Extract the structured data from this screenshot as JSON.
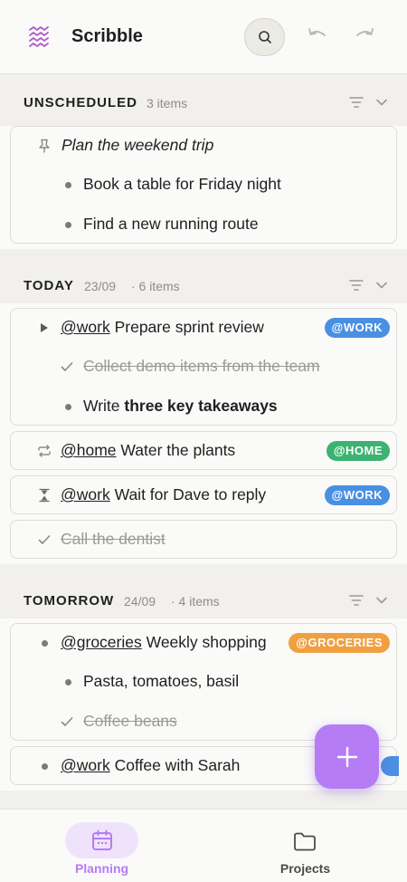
{
  "app": {
    "title": "Scribble"
  },
  "colors": {
    "accent": "#b57cf5",
    "tag_work": "#4a90e2",
    "tag_home": "#3cb371",
    "tag_groceries": "#f0a040"
  },
  "toolbar": {
    "search_icon": "search-icon",
    "undo_icon": "undo-icon",
    "redo_icon": "redo-icon"
  },
  "sections": {
    "unscheduled": {
      "title": "UNSCHEDULED",
      "meta": "3 items",
      "items": [
        {
          "text": "Plan the weekend trip"
        },
        {
          "text": "Book a table for Friday night"
        },
        {
          "text": "Find a new running route"
        }
      ]
    },
    "today": {
      "title": "TODAY",
      "date": "23/09",
      "meta": "· 6 items",
      "items": [
        {
          "mention": "@work",
          "text": " Prepare sprint review",
          "tag": "@WORK"
        },
        {
          "text": "Collect demo items from the team"
        },
        {
          "prefix": "Write ",
          "bold": "three key takeaways"
        },
        {
          "mention": "@home",
          "text": " Water the plants",
          "tag": "@HOME"
        },
        {
          "mention": "@work",
          "text": " Wait for Dave to reply",
          "tag": "@WORK"
        },
        {
          "text": "Call the dentist"
        }
      ]
    },
    "tomorrow": {
      "title": "TOMORROW",
      "date": "24/09",
      "meta": "· 4 items",
      "items": [
        {
          "mention": "@groceries",
          "text": " Weekly shopping",
          "tag": "@GROCERIES"
        },
        {
          "text": "Pasta, tomatoes, basil"
        },
        {
          "text": "Coffee beans"
        },
        {
          "mention": "@work",
          "text": " Coffee with Sarah"
        }
      ]
    }
  },
  "nav": {
    "planning": "Planning",
    "projects": "Projects"
  }
}
